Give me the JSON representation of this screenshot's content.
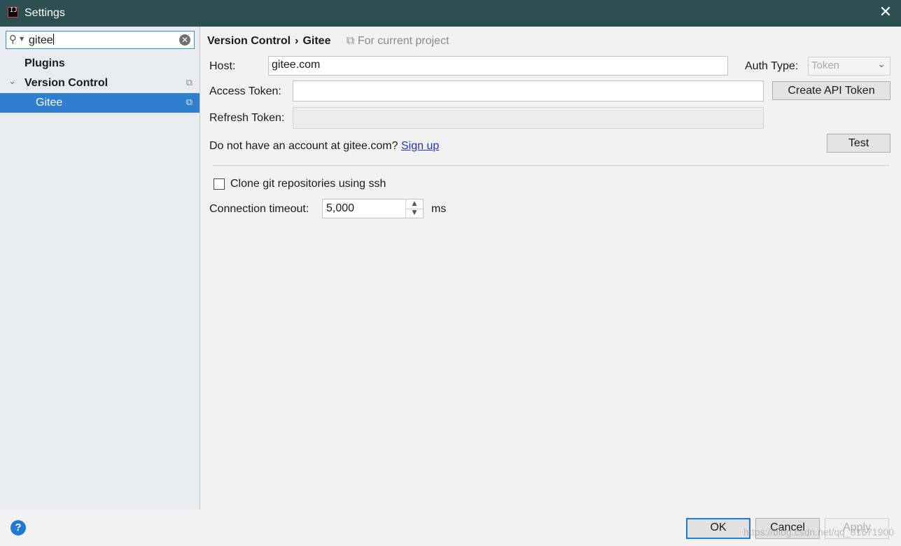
{
  "window": {
    "title": "Settings",
    "app_icon": "intellij-icon",
    "close_icon": "close-icon"
  },
  "sidebar": {
    "search": {
      "value": "gitee"
    },
    "items": [
      {
        "label": "Plugins"
      },
      {
        "label": "Version Control",
        "expanded": true
      },
      {
        "label": "Gitee",
        "selected": true
      }
    ]
  },
  "breadcrumb": {
    "parent": "Version Control",
    "separator": "›",
    "current": "Gitee",
    "scope": "For current project"
  },
  "form": {
    "host_label": "Host:",
    "host_value": "gitee.com",
    "auth_type_label": "Auth Type:",
    "auth_type_value": "Token",
    "access_token_label": "Access Token:",
    "access_token_value": "",
    "create_token_button": "Create API Token",
    "refresh_token_label": "Refresh Token:",
    "refresh_token_value": "",
    "account_prompt": "Do not have an account at gitee.com?",
    "signup_link": "Sign up",
    "test_button": "Test",
    "clone_ssh_label": "Clone git repositories using ssh",
    "clone_ssh_checked": false,
    "timeout_label": "Connection timeout:",
    "timeout_value": "5,000",
    "timeout_unit": "ms"
  },
  "footer": {
    "ok": "OK",
    "cancel": "Cancel",
    "apply": "Apply",
    "watermark": "https://blog.csdn.net/qq_31671900"
  },
  "colors": {
    "titlebar": "#2d4f51",
    "selection": "#2f7ed0",
    "link": "#2331cc",
    "accent": "#1f7ad6"
  }
}
